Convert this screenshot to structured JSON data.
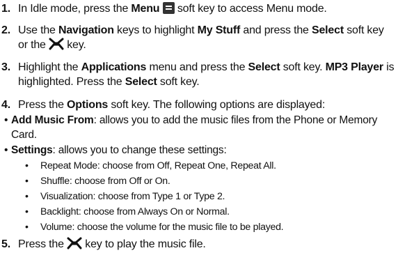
{
  "steps": [
    {
      "num": "1.",
      "a": "In Idle mode, press the ",
      "b1": "Menu",
      "c": " soft key to access Menu mode.",
      "icon": "menu-softkey-icon"
    },
    {
      "num": "2.",
      "a": "Use the ",
      "b1": "Navigation",
      "c": " keys to highlight ",
      "b2": "My Stuff",
      "d": " and press the ",
      "b3": "Select",
      "e": " soft key or the ",
      "f": " key.",
      "icon": "center-key-icon"
    },
    {
      "num": "3.",
      "a": "Highlight the ",
      "b1": "Applications",
      "c": " menu and press the ",
      "b2": "Select",
      "d": " soft key. ",
      "b3": "MP3 Player",
      "e": " is highlighted. Press the ",
      "b4": "Select",
      "f": " soft key."
    },
    {
      "num": "4.",
      "a": "Press the ",
      "b1": "Options",
      "c": " soft key. The following options are displayed:"
    },
    {
      "num": "5.",
      "a": "Press the ",
      "c": " key to play the music file.",
      "icon": "center-key-icon"
    }
  ],
  "options": [
    {
      "bullet": "•",
      "label": "Add Music From",
      "text": ": allows you to add the music files from the Phone or Memory Card."
    },
    {
      "bullet": "•",
      "label": "Settings",
      "text": ": allows you to change these settings:"
    }
  ],
  "settings": [
    {
      "bullet": "•",
      "text": "Repeat Mode: choose from Off, Repeat One, Repeat All."
    },
    {
      "bullet": "•",
      "text": "Shuffle: choose from Off or On."
    },
    {
      "bullet": "•",
      "text": "Visualization: choose from Type 1 or Type 2."
    },
    {
      "bullet": "•",
      "text": "Backlight: choose from Always On or Normal."
    },
    {
      "bullet": "•",
      "text": "Volume: choose the volume for the music file to be played."
    }
  ]
}
